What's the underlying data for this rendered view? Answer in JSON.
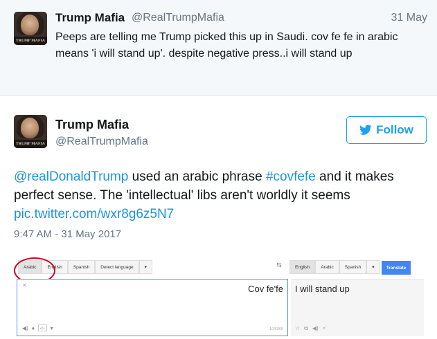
{
  "quoted_tweet": {
    "avatar_caption": "TRUMP MAFIA",
    "name": "Trump Mafia",
    "handle": "@RealTrumpMafia",
    "date": "31 May",
    "text": "Peeps are telling me Trump picked this up in Saudi. cov fe fe in arabic means 'i will stand up'. despite negative press..i will stand up"
  },
  "tweet": {
    "avatar_caption": "TRUMP MAFIA",
    "name": "Trump Mafia",
    "handle": "@RealTrumpMafia",
    "follow_label": "Follow",
    "mention": "@realDonaldTrump",
    "text_1": " used an arabic phrase ",
    "hashtag": "#covfefe",
    "text_2": " and it makes perfect sense. The 'intellectual' libs aren't worldly it seems ",
    "pic_link": "pic.twitter.com/wxr8g6z5N7",
    "timestamp": "9:47 AM - 31 May 2017"
  },
  "translate_screenshot": {
    "source_langs": [
      "Arabic",
      "English",
      "Spanish",
      "Detect language"
    ],
    "target_langs": [
      "English",
      "Arabic",
      "Spanish"
    ],
    "translate_label": "Translate",
    "source_text": "Cov fe'fe",
    "translated_text": "I will stand up",
    "char_count": "10/5000",
    "clear_icon": "close-icon",
    "swap_icon": "swap-icon"
  },
  "colors": {
    "link": "#1b95e0",
    "follow": "#1da1f2",
    "translate_button": "#4285f4",
    "highlight_circle": "#d0021b"
  }
}
